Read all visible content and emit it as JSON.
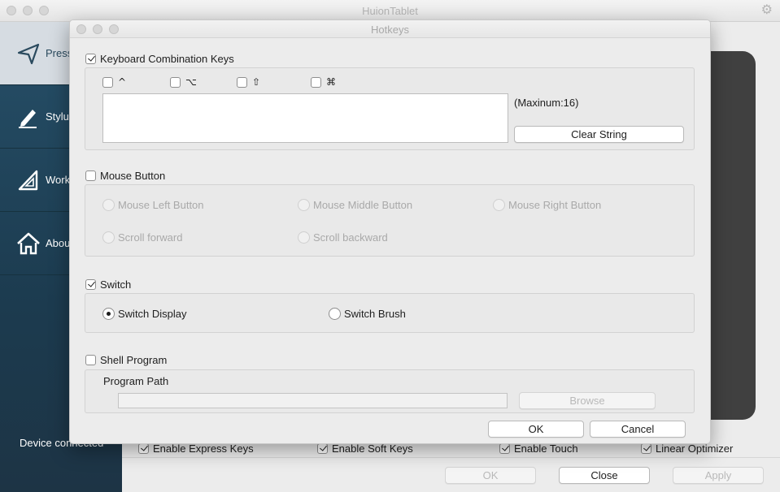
{
  "main_window": {
    "title": "HuionTablet",
    "sidebar": {
      "items": [
        {
          "label": "Press",
          "icon": "paper-plane-icon"
        },
        {
          "label": "Stylus",
          "icon": "pen-icon"
        },
        {
          "label": "Work",
          "icon": "set-square-icon"
        },
        {
          "label": "About",
          "icon": "home-icon"
        }
      ],
      "device_status": "Device connected"
    },
    "options": {
      "express_keys": {
        "label": "Enable Express Keys",
        "checked": true
      },
      "soft_keys": {
        "label": "Enable Soft Keys",
        "checked": true
      },
      "touch": {
        "label": "Enable Touch",
        "checked": true
      },
      "linear_optimizer": {
        "label": "Linear Optimizer",
        "checked": true
      }
    },
    "buttons": {
      "ok": "OK",
      "close": "Close",
      "apply": "Apply"
    }
  },
  "hotkeys_dialog": {
    "title": "Hotkeys",
    "keyboard": {
      "label": "Keyboard Combination Keys",
      "checked": true,
      "modifiers": [
        {
          "glyph": "^",
          "name": "control"
        },
        {
          "glyph": "⌥",
          "name": "option"
        },
        {
          "glyph": "⇧",
          "name": "shift"
        },
        {
          "glyph": "⌘",
          "name": "command"
        }
      ],
      "key_string": "",
      "max_note": "(Maxinum:16)",
      "clear_label": "Clear String"
    },
    "mouse": {
      "label": "Mouse Button",
      "checked": false,
      "options": {
        "left": "Mouse Left Button",
        "middle": "Mouse Middle Button",
        "right": "Mouse Right Button",
        "scroll_forward": "Scroll forward",
        "scroll_backward": "Scroll backward"
      }
    },
    "switch": {
      "label": "Switch",
      "checked": true,
      "display": "Switch Display",
      "brush": "Switch Brush",
      "selected": "Switch Display"
    },
    "shell": {
      "label": "Shell Program",
      "checked": false,
      "path_label": "Program Path",
      "path_value": "",
      "browse_label": "Browse"
    },
    "ok_label": "OK",
    "cancel_label": "Cancel"
  }
}
